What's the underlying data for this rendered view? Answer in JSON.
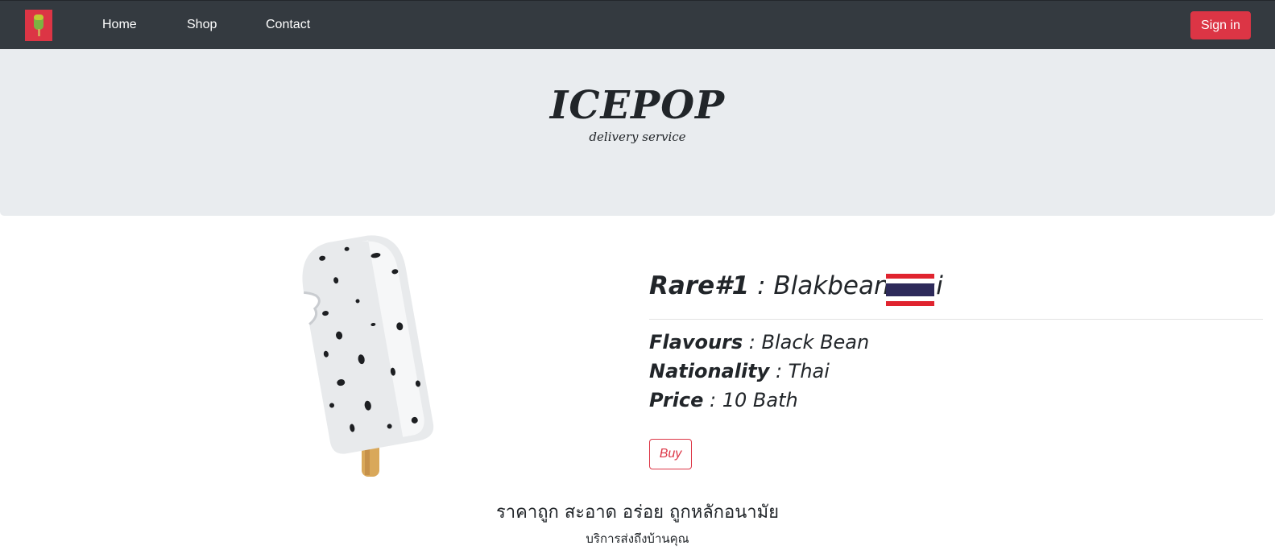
{
  "nav": {
    "logo_icon": "icepop-logo-icon",
    "links": [
      {
        "label": "Home"
      },
      {
        "label": "Shop"
      },
      {
        "label": "Contact"
      }
    ],
    "signin_label": "Sign in"
  },
  "hero": {
    "title": "ICEPOP",
    "subtitle": "delivery service"
  },
  "product": {
    "image_icon": "black-bean-popsicle-image",
    "rare_label": "Rare#1",
    "name": " : BlakbeanThai",
    "flag_icon": "thailand-flag-icon",
    "fields": [
      {
        "label": "Flavours",
        "value": " : Black Bean"
      },
      {
        "label": "Nationality",
        "value": " : Thai"
      },
      {
        "label": "Price",
        "value": " : 10 Bath"
      }
    ],
    "buy_label": "Buy"
  },
  "footer": {
    "tagline": "ราคาถูก สะอาด อร่อย ถูกหลักอนามัย",
    "subline": "บริการส่งถึงบ้านคุณ"
  },
  "colors": {
    "navbar_bg": "#343a40",
    "accent_red": "#dc3545",
    "jumbotron_bg": "#e9ecef",
    "text": "#212529"
  }
}
